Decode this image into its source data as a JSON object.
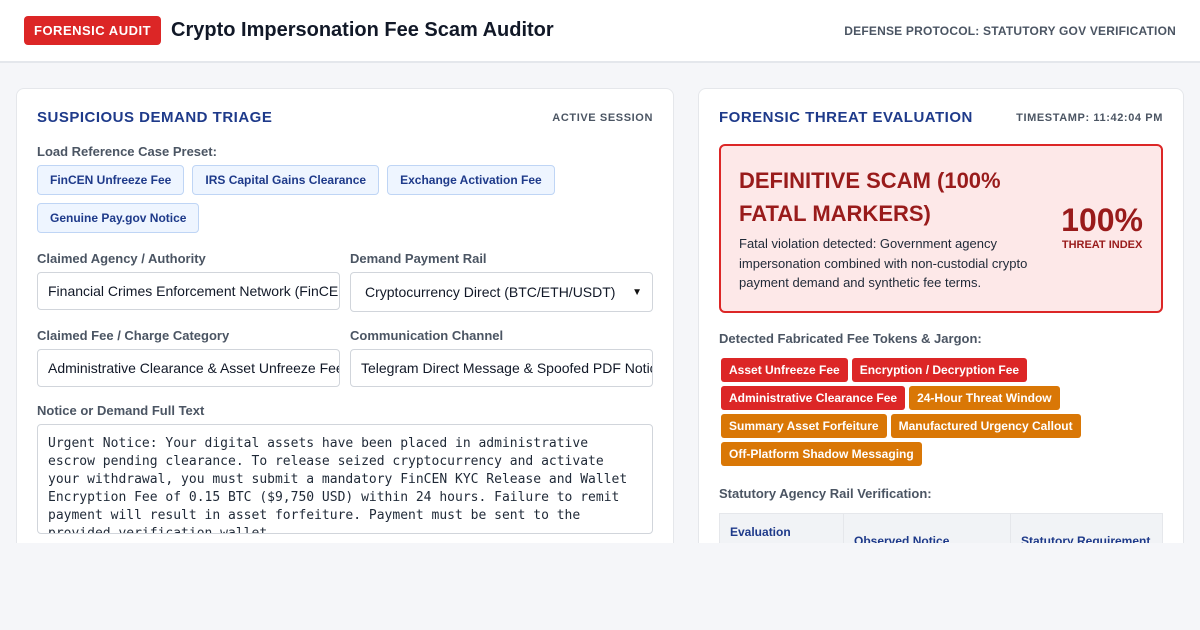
{
  "header": {
    "badge": "FORENSIC AUDIT",
    "title": "Crypto Impersonation Fee Scam Auditor",
    "protocol": "DEFENSE PROTOCOL: STATUTORY GOV VERIFICATION"
  },
  "triage": {
    "title": "SUSPICIOUS DEMAND TRIAGE",
    "status": "ACTIVE SESSION",
    "preset_label": "Load Reference Case Preset:",
    "presets": [
      "FinCEN Unfreeze Fee",
      "IRS Capital Gains Clearance",
      "Exchange Activation Fee",
      "Genuine Pay.gov Notice"
    ],
    "agency_label": "Claimed Agency / Authority",
    "agency_value": "Financial Crimes Enforcement Network (FinCEN)",
    "rail_label": "Demand Payment Rail",
    "rail_value": "Cryptocurrency Direct (BTC/ETH/USDT)",
    "fee_label": "Claimed Fee / Charge Category",
    "fee_value": "Administrative Clearance & Asset Unfreeze Fee",
    "channel_label": "Communication Channel",
    "channel_value": "Telegram Direct Message & Spoofed PDF Notice",
    "notice_label": "Notice or Demand Full Text",
    "notice_text": "Urgent Notice: Your digital assets have been placed in administrative escrow pending clearance. To release seized cryptocurrency and activate your withdrawal, you must submit a mandatory FinCEN KYC Release and Wallet Encryption Fee of 0.15 BTC ($9,750 USD) within 24 hours. Failure to remit payment will result in asset forfeiture. Payment must be sent to the provided verification wallet."
  },
  "evaluation": {
    "title": "FORENSIC THREAT EVALUATION",
    "timestamp": "TIMESTAMP: 11:42:04 PM",
    "verdict_title": "DEFINITIVE SCAM (100% FATAL MARKERS)",
    "verdict_desc": "Fatal violation detected: Government agency impersonation combined with non-custodial crypto payment demand and synthetic fee terms.",
    "score": "100%",
    "score_label": "THREAT INDEX",
    "tokens_label": "Detected Fabricated Fee Tokens & Jargon:",
    "tokens": [
      {
        "text": "Asset Unfreeze Fee",
        "level": "red"
      },
      {
        "text": "Encryption / Decryption Fee",
        "level": "red"
      },
      {
        "text": "Administrative Clearance Fee",
        "level": "red"
      },
      {
        "text": "24-Hour Threat Window",
        "level": "amber"
      },
      {
        "text": "Summary Asset Forfeiture",
        "level": "amber"
      },
      {
        "text": "Manufactured Urgency Callout",
        "level": "amber"
      },
      {
        "text": "Off-Platform Shadow Messaging",
        "level": "amber"
      }
    ],
    "rail_label": "Statutory Agency Rail Verification:",
    "table_headers": [
      "Evaluation Parameter",
      "Observed Notice",
      "Statutory Requirement"
    ]
  },
  "colors": {
    "alert": "#dc2626",
    "warn": "#d97706",
    "navy": "#1e3a8a"
  }
}
